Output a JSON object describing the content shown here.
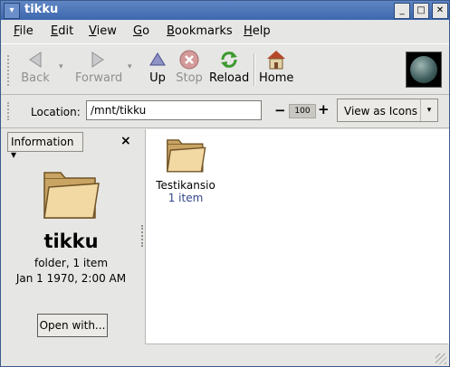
{
  "window": {
    "title": "tikku",
    "menu_glyph": "▾",
    "min_glyph": "_",
    "max_glyph": "□",
    "close_glyph": "✕"
  },
  "menubar": [
    "File",
    "Edit",
    "View",
    "Go",
    "Bookmarks",
    "Help"
  ],
  "toolbar": {
    "back": "Back",
    "forward": "Forward",
    "up": "Up",
    "stop": "Stop",
    "reload": "Reload",
    "home": "Home",
    "dropdown_glyph": "▾"
  },
  "location": {
    "label": "Location:",
    "value": "/mnt/tikku"
  },
  "zoom": {
    "minus": "−",
    "value": "100",
    "plus": "+"
  },
  "view": {
    "label": "View as Icons",
    "dropdown_glyph": "▾"
  },
  "sidebar": {
    "select_label": "Information ▾",
    "close_glyph": "×",
    "name": "tikku",
    "type": "folder, 1 item",
    "date": "Jan 1 1970, 2:00 AM",
    "open_with": "Open with..."
  },
  "files": [
    {
      "name": "Testikansio",
      "count": "1 item"
    }
  ],
  "colors": {
    "titlebar": "#4a72b5",
    "folder": "#e9c98a",
    "count_text": "#33468a"
  }
}
